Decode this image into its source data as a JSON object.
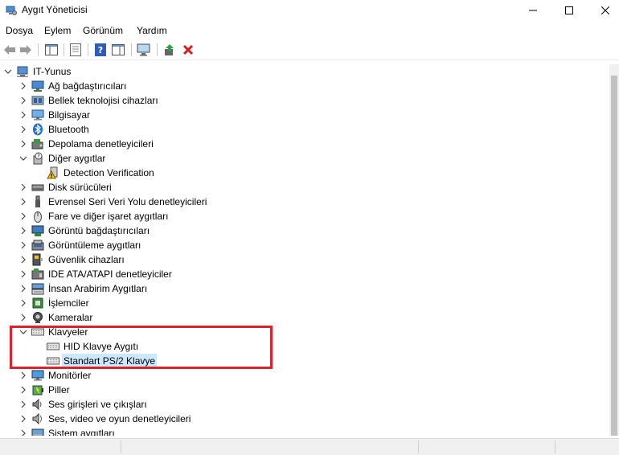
{
  "window": {
    "title": "Aygıt Yöneticisi"
  },
  "menu": [
    "Dosya",
    "Eylem",
    "Görünüm",
    "Yardım"
  ],
  "tree": {
    "root": "IT-Yunus",
    "items": [
      {
        "label": "Ağ bağdaştırıcıları",
        "icon": "network-adapter-icon",
        "expanded": false
      },
      {
        "label": "Bellek teknolojisi cihazları",
        "icon": "memory-device-icon",
        "expanded": false
      },
      {
        "label": "Bilgisayar",
        "icon": "computer-icon",
        "expanded": false
      },
      {
        "label": "Bluetooth",
        "icon": "bluetooth-icon",
        "expanded": false
      },
      {
        "label": "Depolama denetleyicileri",
        "icon": "storage-controller-icon",
        "expanded": false
      },
      {
        "label": "Diğer aygıtlar",
        "icon": "other-devices-icon",
        "expanded": true,
        "children": [
          {
            "label": "Detection Verification",
            "icon": "warning-device-icon"
          }
        ]
      },
      {
        "label": "Disk sürücüleri",
        "icon": "disk-drive-icon",
        "expanded": false
      },
      {
        "label": "Evrensel Seri Veri Yolu denetleyicileri",
        "icon": "usb-icon",
        "expanded": false
      },
      {
        "label": "Fare ve diğer işaret aygıtları",
        "icon": "mouse-icon",
        "expanded": false
      },
      {
        "label": "Görüntü bağdaştırıcıları",
        "icon": "display-adapter-icon",
        "expanded": false
      },
      {
        "label": "Görüntüleme aygıtları",
        "icon": "imaging-device-icon",
        "expanded": false
      },
      {
        "label": "Güvenlik cihazları",
        "icon": "security-device-icon",
        "expanded": false
      },
      {
        "label": "IDE ATA/ATAPI denetleyiciler",
        "icon": "ide-controller-icon",
        "expanded": false
      },
      {
        "label": "İnsan Arabirim Aygıtları",
        "icon": "hid-icon",
        "expanded": false
      },
      {
        "label": "İşlemciler",
        "icon": "processor-icon",
        "expanded": false
      },
      {
        "label": "Kameralar",
        "icon": "camera-icon",
        "expanded": false
      },
      {
        "label": "Klavyeler",
        "icon": "keyboard-icon",
        "expanded": true,
        "children": [
          {
            "label": "HID Klavye Aygıtı",
            "icon": "keyboard-icon"
          },
          {
            "label": "Standart PS/2 Klavye",
            "icon": "keyboard-icon",
            "selected": true
          }
        ]
      },
      {
        "label": "Monitörler",
        "icon": "monitor-icon",
        "expanded": false
      },
      {
        "label": "Piller",
        "icon": "battery-icon",
        "expanded": false
      },
      {
        "label": "Ses girişleri ve çıkışları",
        "icon": "audio-io-icon",
        "expanded": false
      },
      {
        "label": "Ses, video ve oyun denetleyicileri",
        "icon": "sound-controller-icon",
        "expanded": false
      },
      {
        "label": "Sistem aygıtları",
        "icon": "system-device-icon",
        "expanded": false
      }
    ]
  },
  "colors": {
    "selection": "#cce8ff",
    "highlight": "#d9232e"
  }
}
